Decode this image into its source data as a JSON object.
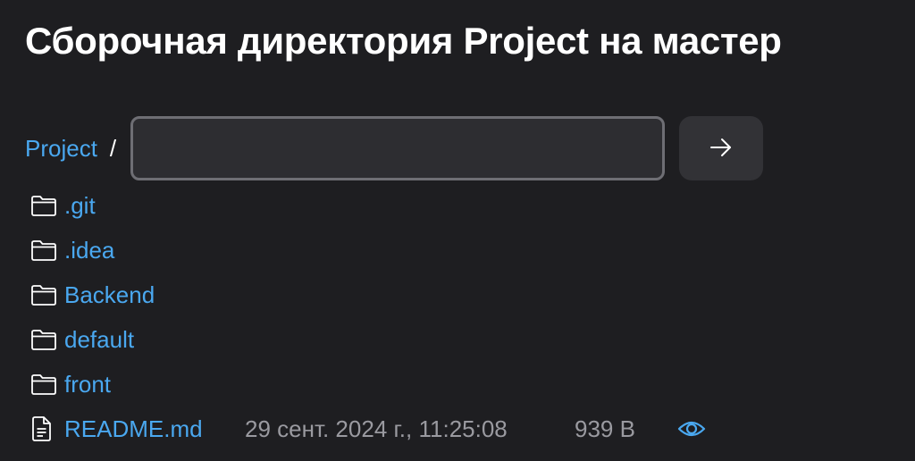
{
  "header": {
    "title": "Сборочная директория Project на мастер"
  },
  "path": {
    "root_label": "Project",
    "separator": "/",
    "input_value": "",
    "go_icon": "arrow-right-icon"
  },
  "entries": [
    {
      "name": ".git",
      "type": "folder",
      "icon": "folder-icon"
    },
    {
      "name": ".idea",
      "type": "folder",
      "icon": "folder-icon"
    },
    {
      "name": "Backend",
      "type": "folder",
      "icon": "folder-icon"
    },
    {
      "name": "default",
      "type": "folder",
      "icon": "folder-icon"
    },
    {
      "name": "front",
      "type": "folder",
      "icon": "folder-icon"
    },
    {
      "name": "README.md",
      "type": "file",
      "icon": "document-icon",
      "modified": "29 сент. 2024 г., 11:25:08",
      "size": "939 B",
      "action_icon": "eye-icon"
    }
  ],
  "colors": {
    "background": "#1e1e21",
    "link": "#4aa8f0",
    "muted": "#9a9aa0",
    "input_bg": "#2d2d31",
    "input_border": "#6e6e74"
  }
}
